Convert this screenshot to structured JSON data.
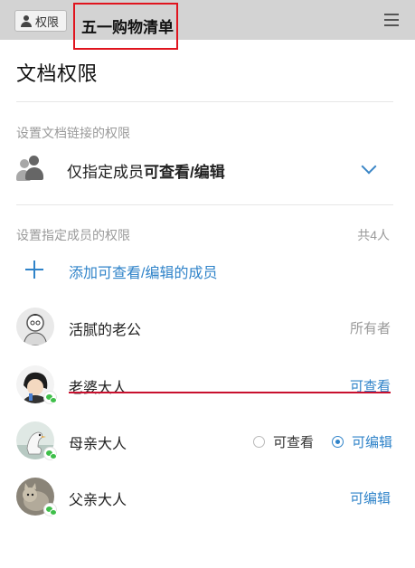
{
  "top_bar": {
    "permission_chip": "权限",
    "document_title": "五一购物清单"
  },
  "page_title": "文档权限",
  "link_section": {
    "label": "设置文档链接的权限",
    "option_text_prefix": "仅指定成员",
    "option_text_bold": "可查看/编辑"
  },
  "members_section": {
    "label": "设置指定成员的权限",
    "count": "共4人",
    "add_label": "添加可查看/编辑的成员"
  },
  "members": [
    {
      "name": "活腻的老公",
      "role": "所有者",
      "role_color": "#9a9a9a",
      "wechat": false
    },
    {
      "name": "老婆大人",
      "role": "可查看",
      "role_color": "#2f83c9",
      "wechat": true
    },
    {
      "name": "母亲大人",
      "option_view": "可查看",
      "option_edit": "可编辑",
      "selected": "可编辑",
      "wechat": true
    },
    {
      "name": "父亲大人",
      "role": "可编辑",
      "role_color": "#2f83c9",
      "wechat": true
    }
  ],
  "colors": {
    "accent": "#2f83c9",
    "annotation_red": "#e0141e",
    "top_bar": "#d3d3d3"
  }
}
